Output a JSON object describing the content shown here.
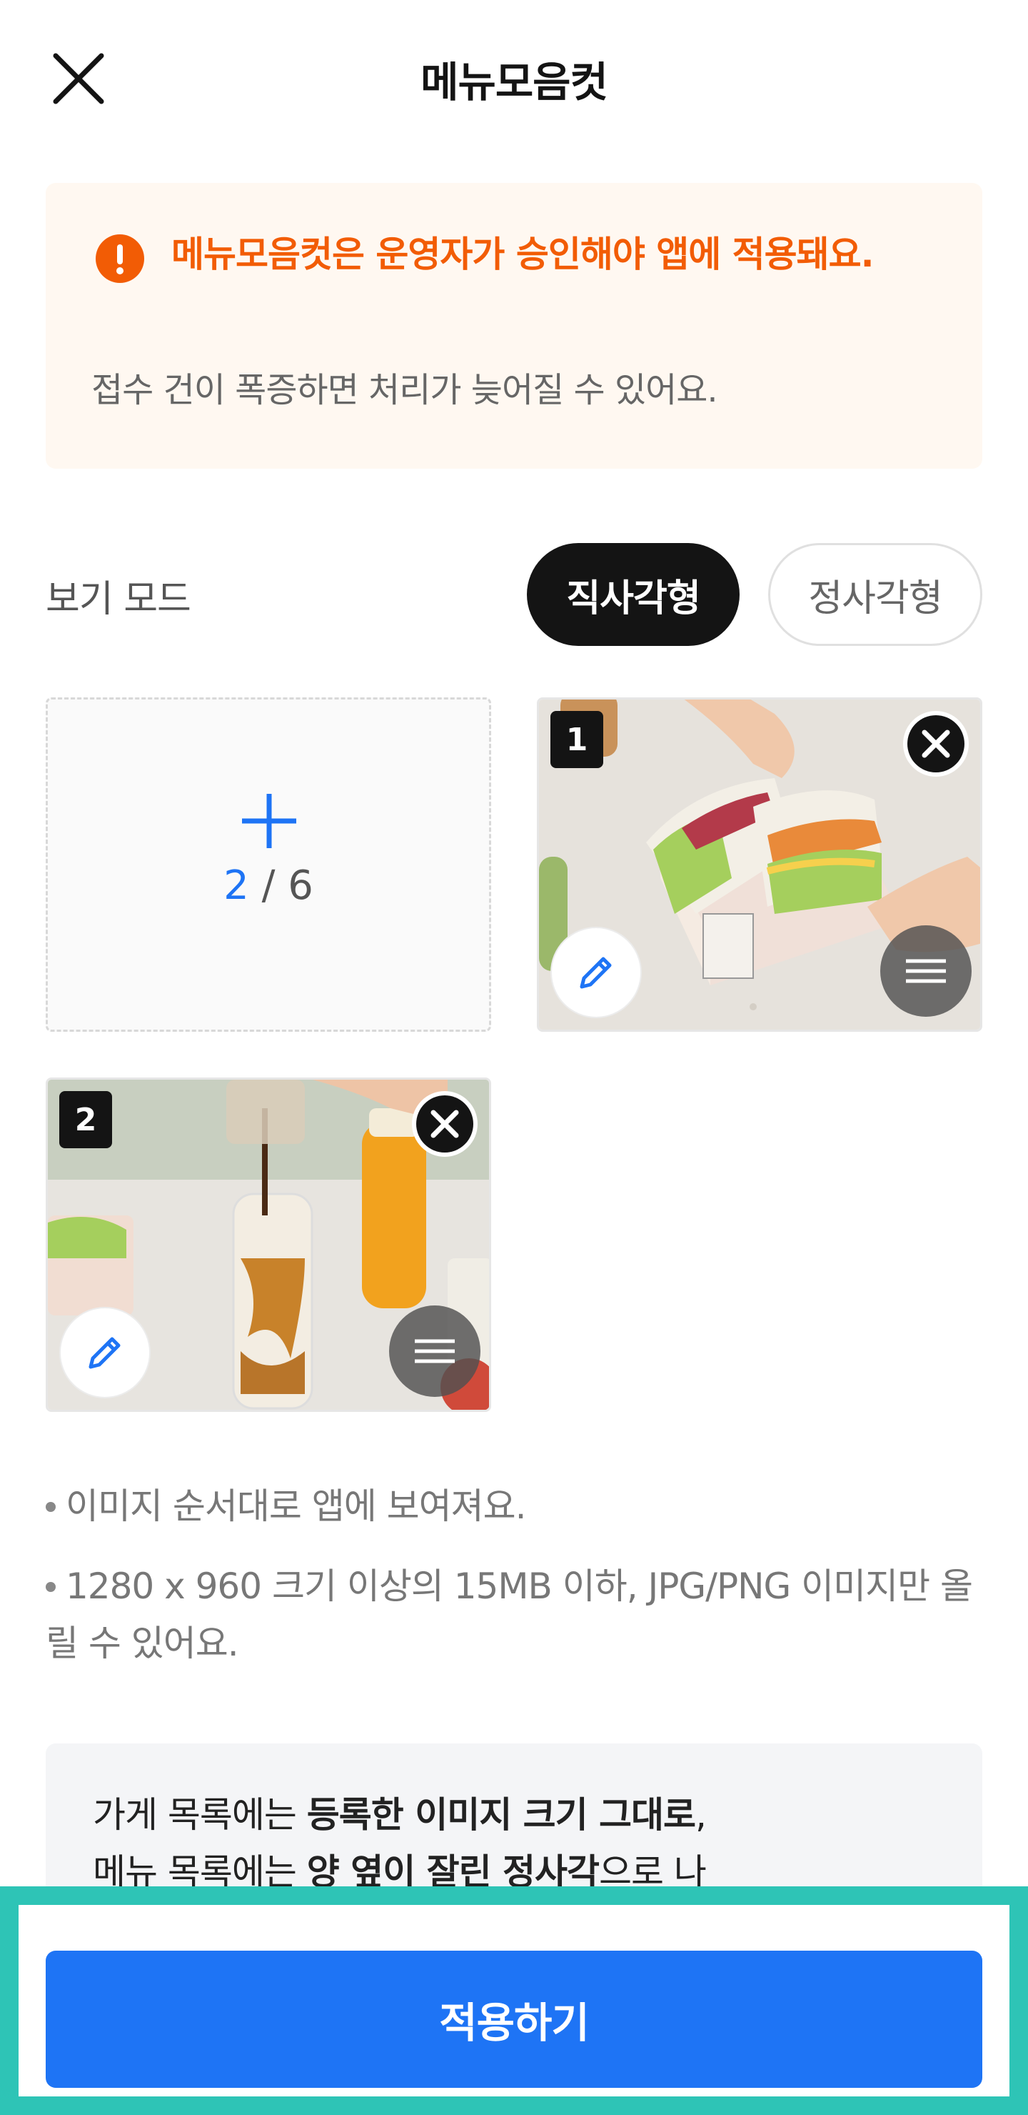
{
  "header": {
    "title": "메뉴모음컷"
  },
  "notice": {
    "title": "메뉴모음컷은 운영자가 승인해야 앱에 적용돼요.",
    "subtitle": "접수 건이 폭증하면 처리가 늦어질 수 있어요.",
    "accent_color": "#f25c05"
  },
  "view_mode": {
    "label": "보기 모드",
    "options": [
      "직사각형",
      "정사각형"
    ],
    "selected": "직사각형"
  },
  "uploader": {
    "current": "2",
    "separator": " / ",
    "max": "6",
    "images": [
      {
        "order": "1",
        "content": "sandwich in paper box held by hands"
      },
      {
        "order": "2",
        "content": "sauce pouring into iced drink bottle"
      }
    ]
  },
  "guides": [
    "이미지 순서대로 앱에 보여져요.",
    "1280 x 960 크기 이상의 15MB 이하, JPG/PNG 이미지만 올릴 수 있어요."
  ],
  "info": {
    "line1_a": "가게 목록에는 ",
    "line1_b": "등록한 이미지 크기 그대로",
    "line1_c": ",",
    "line2_a": "메뉴 목록에는 ",
    "line2_b": "양 옆이 잘린 정사각",
    "line2_c": "으로 나"
  },
  "footer": {
    "apply_label": "적용하기",
    "accent_color": "#1e74f5"
  }
}
